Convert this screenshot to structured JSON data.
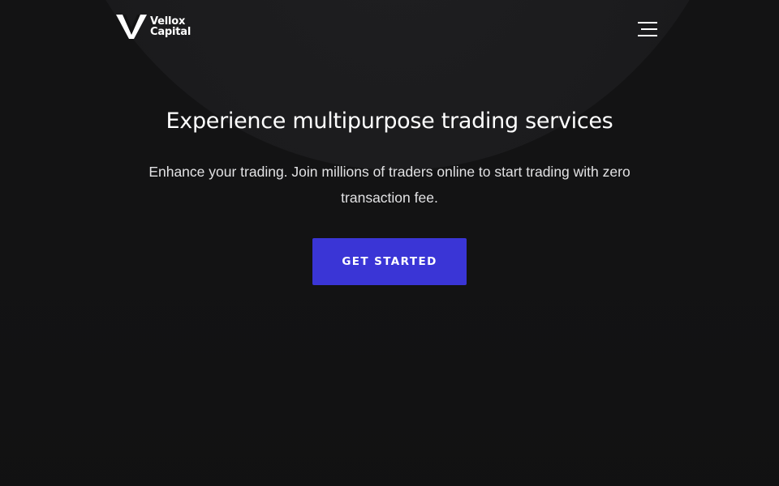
{
  "brand": {
    "name_line1": "Vellox",
    "name_line2": "Capital",
    "logo_icon": "v-logo-icon"
  },
  "header": {
    "menu_icon": "hamburger-menu-icon"
  },
  "hero": {
    "title": "Experience multipurpose trading services",
    "subtitle": "Enhance your trading. Join millions of traders online to start trading with zero transaction fee.",
    "cta_label": "GET STARTED"
  },
  "colors": {
    "background": "#131314",
    "arc": "#1c1c1e",
    "accent": "#3a35d6",
    "text": "#ffffff"
  }
}
